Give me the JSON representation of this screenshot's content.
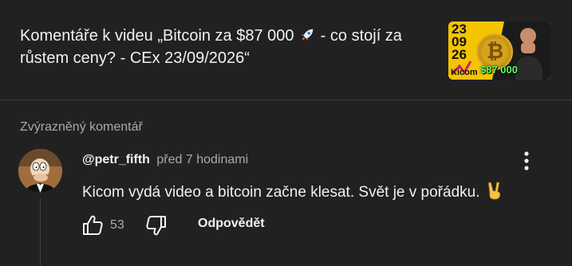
{
  "video": {
    "title_part1": "Komentáře k videu „Bitcoin za $87 000",
    "title_part2": " - co stojí za růstem ceny? - CEx 23/09/2026“",
    "thumbnail": {
      "date_lines": [
        "23",
        "09",
        "26"
      ],
      "brand": "Kicom",
      "price": "$87 000",
      "coin_symbol": "₿",
      "accent_color": "#f5c400"
    }
  },
  "section": {
    "label": "Zvýrazněný komentář"
  },
  "comment": {
    "author": "@petr_fifth",
    "time": "před 7 hodinami",
    "text": "Kicom vydá video a bitcoin začne klesat. Svět je v pořádku.",
    "likes": "53",
    "reply_label": "Odpovědět"
  },
  "icons": {
    "rocket": "rocket-emoji",
    "victory": "victory-hand-emoji",
    "like": "thumbs-up-icon",
    "dislike": "thumbs-down-icon",
    "more": "vertical-dots-icon"
  }
}
